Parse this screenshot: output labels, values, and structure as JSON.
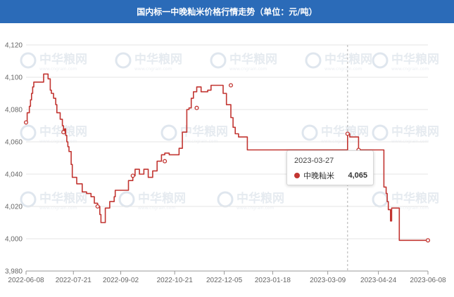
{
  "title": "国内标一中晚籼米价格行情走势（单位：元/吨）",
  "colors": {
    "header": "#2b6bb8",
    "series": "#c23531",
    "grid": "#e6e6e6",
    "axis": "#999999",
    "text": "#666666"
  },
  "watermark": {
    "logo_icon": "zhonghua-liangwang-logo-icon",
    "text": "中华粮网",
    "subtext": "www.cngrain.com"
  },
  "chart_data": {
    "type": "line",
    "ylim": [
      3980,
      4120
    ],
    "y_ticks": [
      3980,
      4000,
      4020,
      4040,
      4060,
      4080,
      4100,
      4120
    ],
    "xlim": [
      "2022-06-08",
      "2023-06-08"
    ],
    "x_ticks": [
      "2022-06-08",
      "2022-07-21",
      "2022-09-02",
      "2022-10-21",
      "2022-12-05",
      "2023-01-18",
      "2023-03-09",
      "2023-04-24",
      "2023-06-08"
    ],
    "grid": true,
    "series": [
      {
        "name": "中晚籼米",
        "step": true,
        "points": [
          [
            "2022-06-08",
            4072
          ],
          [
            "2022-06-09",
            4078
          ],
          [
            "2022-06-11",
            4082
          ],
          [
            "2022-06-12",
            4086
          ],
          [
            "2022-06-13",
            4090
          ],
          [
            "2022-06-14",
            4094
          ],
          [
            "2022-06-15",
            4097
          ],
          [
            "2022-06-24",
            4102
          ],
          [
            "2022-06-28",
            4099
          ],
          [
            "2022-06-30",
            4092
          ],
          [
            "2022-07-01",
            4090
          ],
          [
            "2022-07-03",
            4087
          ],
          [
            "2022-07-05",
            4083
          ],
          [
            "2022-07-06",
            4078
          ],
          [
            "2022-07-09",
            4074
          ],
          [
            "2022-07-11",
            4070
          ],
          [
            "2022-07-12",
            4066
          ],
          [
            "2022-07-13",
            4068
          ],
          [
            "2022-07-14",
            4064
          ],
          [
            "2022-07-15",
            4060
          ],
          [
            "2022-07-16",
            4057
          ],
          [
            "2022-07-17",
            4054
          ],
          [
            "2022-07-19",
            4046
          ],
          [
            "2022-07-20",
            4038
          ],
          [
            "2022-07-24",
            4034
          ],
          [
            "2022-07-29",
            4029
          ],
          [
            "2022-08-02",
            4028
          ],
          [
            "2022-08-06",
            4026
          ],
          [
            "2022-08-09",
            4022
          ],
          [
            "2022-08-12",
            4020
          ],
          [
            "2022-08-14",
            4015
          ],
          [
            "2022-08-15",
            4010
          ],
          [
            "2022-08-18",
            4010
          ],
          [
            "2022-08-19",
            4019
          ],
          [
            "2022-08-23",
            4023
          ],
          [
            "2022-08-27",
            4026
          ],
          [
            "2022-08-28",
            4030
          ],
          [
            "2022-09-09",
            4036
          ],
          [
            "2022-09-13",
            4039
          ],
          [
            "2022-09-15",
            4043
          ],
          [
            "2022-09-19",
            4040
          ],
          [
            "2022-09-23",
            4043
          ],
          [
            "2022-09-27",
            4038
          ],
          [
            "2022-10-01",
            4042
          ],
          [
            "2022-10-05",
            4048
          ],
          [
            "2022-10-09",
            4052
          ],
          [
            "2022-10-12",
            4053
          ],
          [
            "2022-10-16",
            4052
          ],
          [
            "2022-10-25",
            4056
          ],
          [
            "2022-10-28",
            4066
          ],
          [
            "2022-11-01",
            4080
          ],
          [
            "2022-11-03",
            4081
          ],
          [
            "2022-11-05",
            4087
          ],
          [
            "2022-11-07",
            4091
          ],
          [
            "2022-11-10",
            4094
          ],
          [
            "2022-11-14",
            4091
          ],
          [
            "2022-11-20",
            4092
          ],
          [
            "2022-11-23",
            4095
          ],
          [
            "2022-12-01",
            4095
          ],
          [
            "2022-12-04",
            4090
          ],
          [
            "2022-12-07",
            4083
          ],
          [
            "2022-12-11",
            4075
          ],
          [
            "2022-12-13",
            4069
          ],
          [
            "2022-12-15",
            4065
          ],
          [
            "2022-12-18",
            4063
          ],
          [
            "2022-12-26",
            4055
          ],
          [
            "2023-03-27",
            4065
          ],
          [
            "2023-03-29",
            4063
          ],
          [
            "2023-04-06",
            4055
          ],
          [
            "2023-04-28",
            4055
          ],
          [
            "2023-04-29",
            4032
          ],
          [
            "2023-05-01",
            4028
          ],
          [
            "2023-05-02",
            4023
          ],
          [
            "2023-05-03",
            4018
          ],
          [
            "2023-05-05",
            4011
          ],
          [
            "2023-05-06",
            4019
          ],
          [
            "2023-05-11",
            4019
          ],
          [
            "2023-05-13",
            3999
          ],
          [
            "2023-06-08",
            3999
          ]
        ],
        "markers": [
          [
            "2022-06-08",
            4072
          ],
          [
            "2022-07-12",
            4066
          ],
          [
            "2022-08-12",
            4020
          ],
          [
            "2022-09-13",
            4039
          ],
          [
            "2022-10-12",
            4048
          ],
          [
            "2022-11-10",
            4081
          ],
          [
            "2022-12-11",
            4095
          ],
          [
            "2023-03-27",
            4065
          ],
          [
            "2023-04-06",
            4055
          ],
          [
            "2023-06-08",
            3999
          ]
        ]
      }
    ],
    "x_hover": "2023-03-27"
  },
  "tooltip": {
    "date": "2023-03-27",
    "series_name": "中晚籼米",
    "value": "4,065"
  }
}
